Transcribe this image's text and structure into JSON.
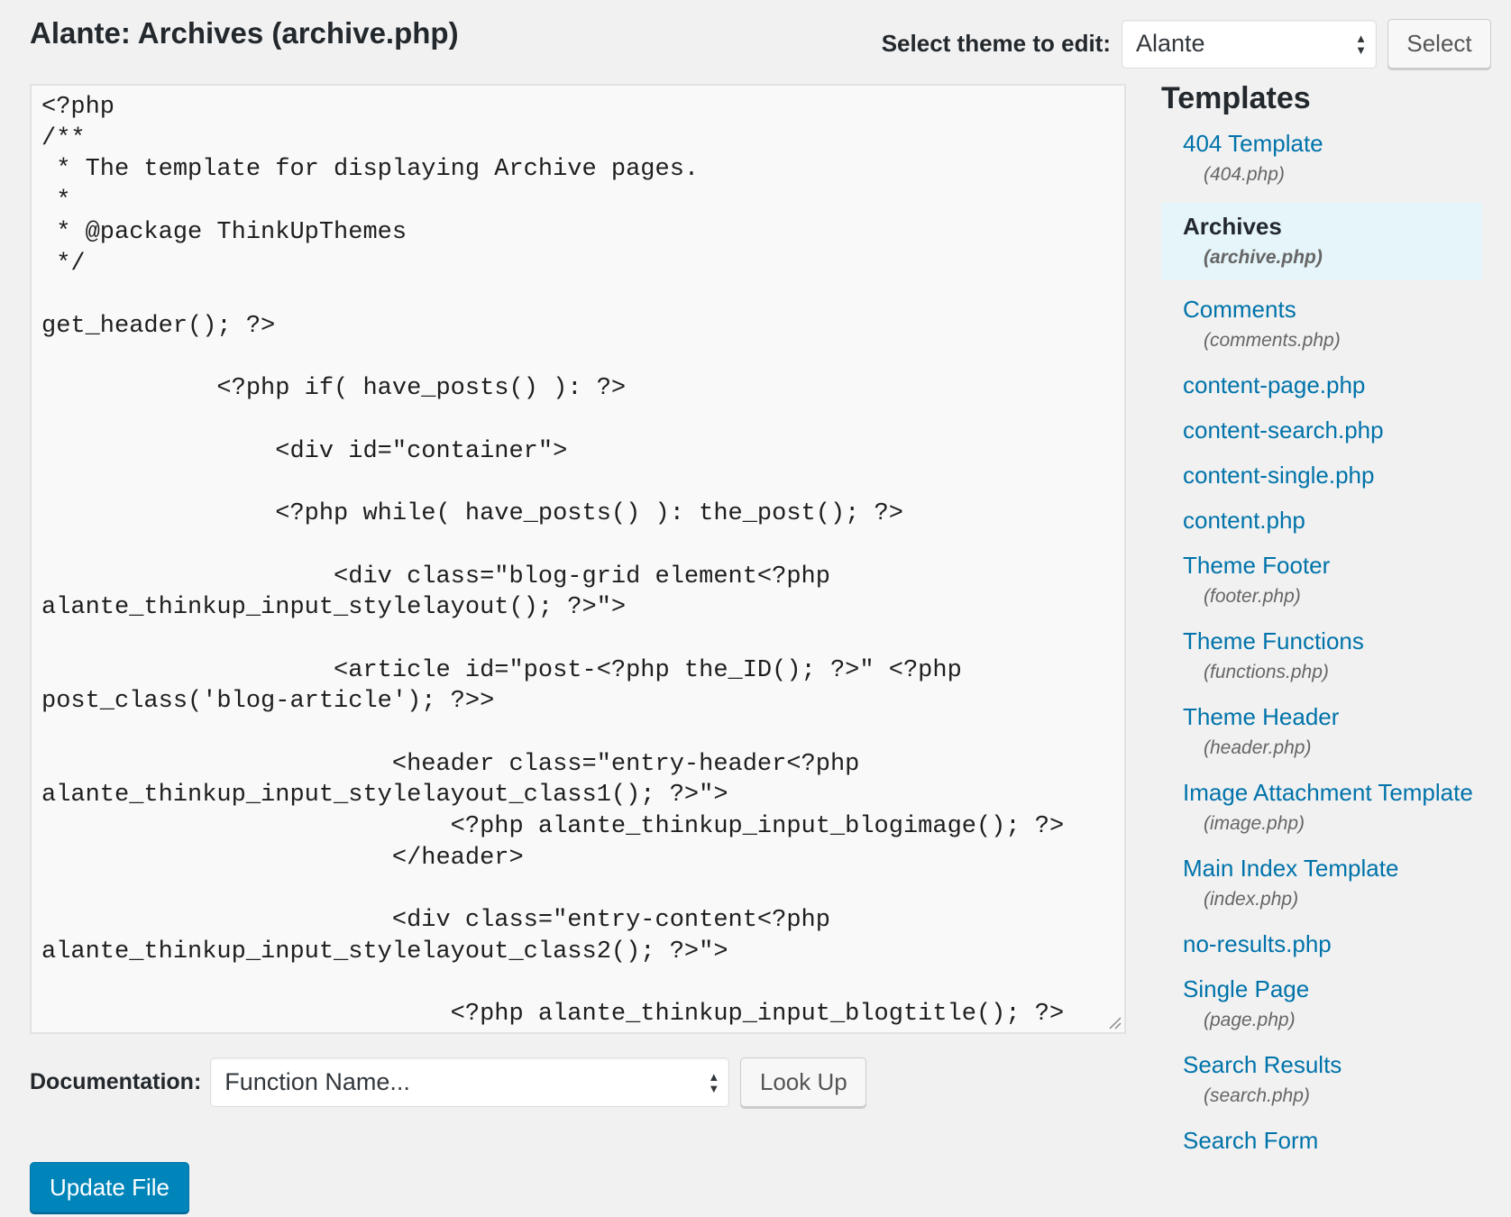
{
  "header": {
    "file_title": "Alante: Archives (archive.php)",
    "theme_select_label": "Select theme to edit:",
    "theme_selected": "Alante",
    "select_button": "Select"
  },
  "editor": {
    "code": "<?php\n/**\n * The template for displaying Archive pages.\n *\n * @package ThinkUpThemes\n */\n\nget_header(); ?>\n\n            <?php if( have_posts() ): ?>\n\n                <div id=\"container\">\n\n                <?php while( have_posts() ): the_post(); ?>\n\n                    <div class=\"blog-grid element<?php\nalante_thinkup_input_stylelayout(); ?>\">\n\n                    <article id=\"post-<?php the_ID(); ?>\" <?php\npost_class('blog-article'); ?>>\n\n                        <header class=\"entry-header<?php\nalante_thinkup_input_stylelayout_class1(); ?>\">\n                            <?php alante_thinkup_input_blogimage(); ?>\n                        </header>\n\n                        <div class=\"entry-content<?php\nalante_thinkup_input_stylelayout_class2(); ?>\">\n\n                            <?php alante_thinkup_input_blogtitle(); ?>"
  },
  "documentation": {
    "label": "Documentation:",
    "selected": "Function Name...",
    "lookup_button": "Look Up"
  },
  "update_button": "Update File",
  "templates": {
    "heading": "Templates",
    "items": [
      {
        "name": "404 Template",
        "file": "(404.php)",
        "active": false
      },
      {
        "name": "Archives",
        "file": "(archive.php)",
        "active": true
      },
      {
        "name": "Comments",
        "file": "(comments.php)",
        "active": false
      },
      {
        "name": "content-page.php",
        "file": "",
        "active": false
      },
      {
        "name": "content-search.php",
        "file": "",
        "active": false
      },
      {
        "name": "content-single.php",
        "file": "",
        "active": false
      },
      {
        "name": "content.php",
        "file": "",
        "active": false
      },
      {
        "name": "Theme Footer",
        "file": "(footer.php)",
        "active": false
      },
      {
        "name": "Theme Functions",
        "file": "(functions.php)",
        "active": false
      },
      {
        "name": "Theme Header",
        "file": "(header.php)",
        "active": false
      },
      {
        "name": "Image Attachment Template",
        "file": "(image.php)",
        "active": false
      },
      {
        "name": "Main Index Template",
        "file": "(index.php)",
        "active": false
      },
      {
        "name": "no-results.php",
        "file": "",
        "active": false
      },
      {
        "name": "Single Page",
        "file": "(page.php)",
        "active": false
      },
      {
        "name": "Search Results",
        "file": "(search.php)",
        "active": false
      },
      {
        "name": "Search Form",
        "file": "",
        "active": false
      }
    ]
  }
}
